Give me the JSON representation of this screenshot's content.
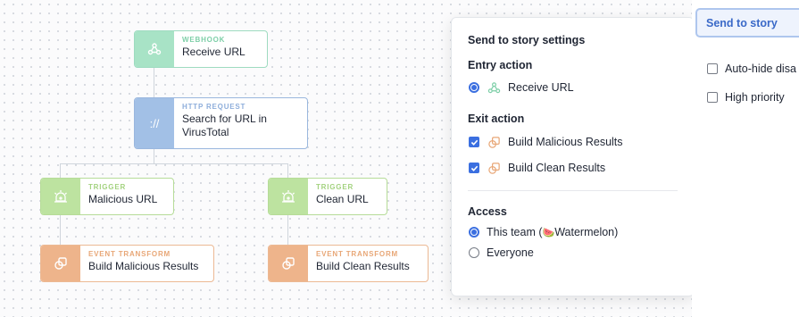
{
  "nodes": {
    "webhook": {
      "type": "WEBHOOK",
      "name": "Receive URL"
    },
    "http": {
      "type": "HTTP REQUEST",
      "name_line1": "Search for URL in",
      "name_line2": "VirusTotal",
      "icon_text": "://"
    },
    "trigger_malicious": {
      "type": "TRIGGER",
      "name": "Malicious URL"
    },
    "trigger_clean": {
      "type": "TRIGGER",
      "name": "Clean URL"
    },
    "transform_malicious": {
      "type": "EVENT TRANSFORM",
      "name": "Build Malicious Results"
    },
    "transform_clean": {
      "type": "EVENT TRANSFORM",
      "name": "Build Clean Results"
    }
  },
  "panel": {
    "title": "Send to story settings",
    "entry_heading": "Entry action",
    "entry_option": {
      "label": "Receive URL",
      "selected": true,
      "icon": "webhook-icon"
    },
    "exit_heading": "Exit action",
    "exit_options": [
      {
        "label": "Build Malicious Results",
        "checked": true,
        "icon": "event-transform-icon"
      },
      {
        "label": "Build Clean Results",
        "checked": true,
        "icon": "event-transform-icon"
      }
    ],
    "access_heading": "Access",
    "access_options": [
      {
        "label": "This team (",
        "emoji": "🍉",
        "team": "Watermelon)",
        "selected": true
      },
      {
        "label": "Everyone",
        "selected": false
      }
    ]
  },
  "sidebar": {
    "tab_label": "Send to story",
    "options": [
      {
        "label": "Auto-hide disa",
        "checked": false
      },
      {
        "label": "High priority",
        "checked": false
      }
    ]
  },
  "colors": {
    "accent": "#3b6fe0",
    "webhook": "#a8e3c6",
    "http": "#a2c0e6",
    "trigger": "#bde3a0",
    "transform": "#eeb48b"
  }
}
